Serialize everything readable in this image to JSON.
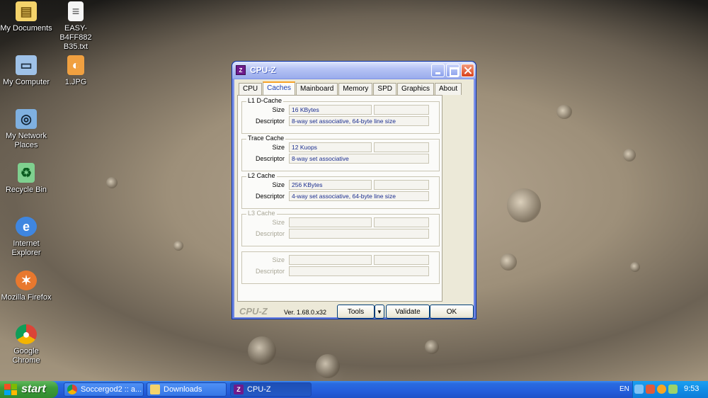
{
  "desktop": {
    "icons": [
      {
        "label": "My Documents",
        "icon": "folder-documents-icon",
        "color": "#f4d36b"
      },
      {
        "label": "EASY-B4FF882\nB35.txt",
        "icon": "text-file-icon",
        "color": "#f5f5f5"
      },
      {
        "label": "My Computer",
        "icon": "computer-icon",
        "color": "#9fc2e8"
      },
      {
        "label": "1.JPG",
        "icon": "image-file-icon",
        "color": "#f0a040"
      },
      {
        "label": "My Network\nPlaces",
        "icon": "network-icon",
        "color": "#7fb0e0"
      },
      {
        "label": "Recycle Bin",
        "icon": "recycle-bin-icon",
        "color": "#7fd08f"
      },
      {
        "label": "Internet\nExplorer",
        "icon": "internet-explorer-icon",
        "color": "#3f86e0"
      },
      {
        "label": "Mozilla Firefox",
        "icon": "firefox-icon",
        "color": "#e8782e"
      },
      {
        "label": "Google\nChrome",
        "icon": "chrome-icon",
        "color": "#4caf50"
      }
    ]
  },
  "window": {
    "title": "CPU-Z",
    "app_icon_text": "Z",
    "tabs": [
      "CPU",
      "Caches",
      "Mainboard",
      "Memory",
      "SPD",
      "Graphics",
      "About"
    ],
    "active_tab": "Caches",
    "groups": [
      {
        "legend": "L1 D-Cache",
        "size_label": "Size",
        "size_value": "16 KBytes",
        "desc_label": "Descriptor",
        "desc_value": "8-way set associative, 64-byte line size",
        "disabled": false
      },
      {
        "legend": "Trace Cache",
        "size_label": "Size",
        "size_value": "12 Kuops",
        "desc_label": "Descriptor",
        "desc_value": "8-way set associative",
        "disabled": false
      },
      {
        "legend": "L2 Cache",
        "size_label": "Size",
        "size_value": "256 KBytes",
        "desc_label": "Descriptor",
        "desc_value": "4-way set associative, 64-byte line size",
        "disabled": false
      },
      {
        "legend": "L3 Cache",
        "size_label": "Size",
        "size_value": "",
        "desc_label": "Descriptor",
        "desc_value": "",
        "disabled": true
      },
      {
        "legend": "",
        "size_label": "Size",
        "size_value": "",
        "desc_label": "Descriptor",
        "desc_value": "",
        "disabled": true
      }
    ],
    "footer": {
      "brand": "CPU-Z",
      "version": "Ver. 1.68.0.x32",
      "tools_label": "Tools",
      "validate_label": "Validate",
      "ok_label": "OK"
    }
  },
  "taskbar": {
    "start_label": "start",
    "tasks": [
      {
        "label": "Soccergod2 :: a...",
        "icon": "chrome-icon",
        "active": false
      },
      {
        "label": "Downloads",
        "icon": "folder-icon",
        "active": false
      },
      {
        "label": "CPU-Z",
        "icon": "cpu-z-icon",
        "active": true
      }
    ],
    "language": "EN",
    "clock": "9:53"
  }
}
